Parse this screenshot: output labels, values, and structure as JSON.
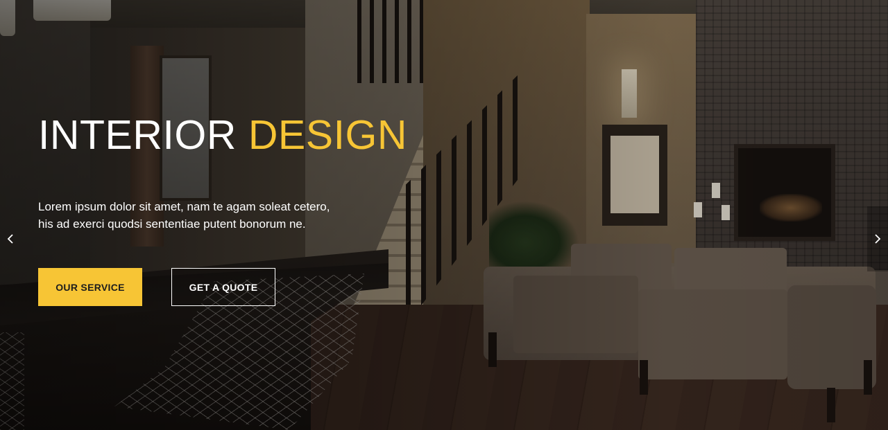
{
  "hero": {
    "title_main": "INTERIOR",
    "title_accent": "DESIGN",
    "subtitle_line1": "Lorem ipsum dolor sit amet, nam te agam soleat cetero,",
    "subtitle_line2": "his ad exerci quodsi sententiae putent bonorum ne.",
    "primary_button": "OUR SERVICE",
    "secondary_button": "GET A QUOTE",
    "prev_icon": "chevron-left-icon",
    "next_icon": "chevron-right-icon"
  },
  "colors": {
    "accent": "#f7c535",
    "text": "#ffffff",
    "button_text_dark": "#1d1d1d"
  }
}
